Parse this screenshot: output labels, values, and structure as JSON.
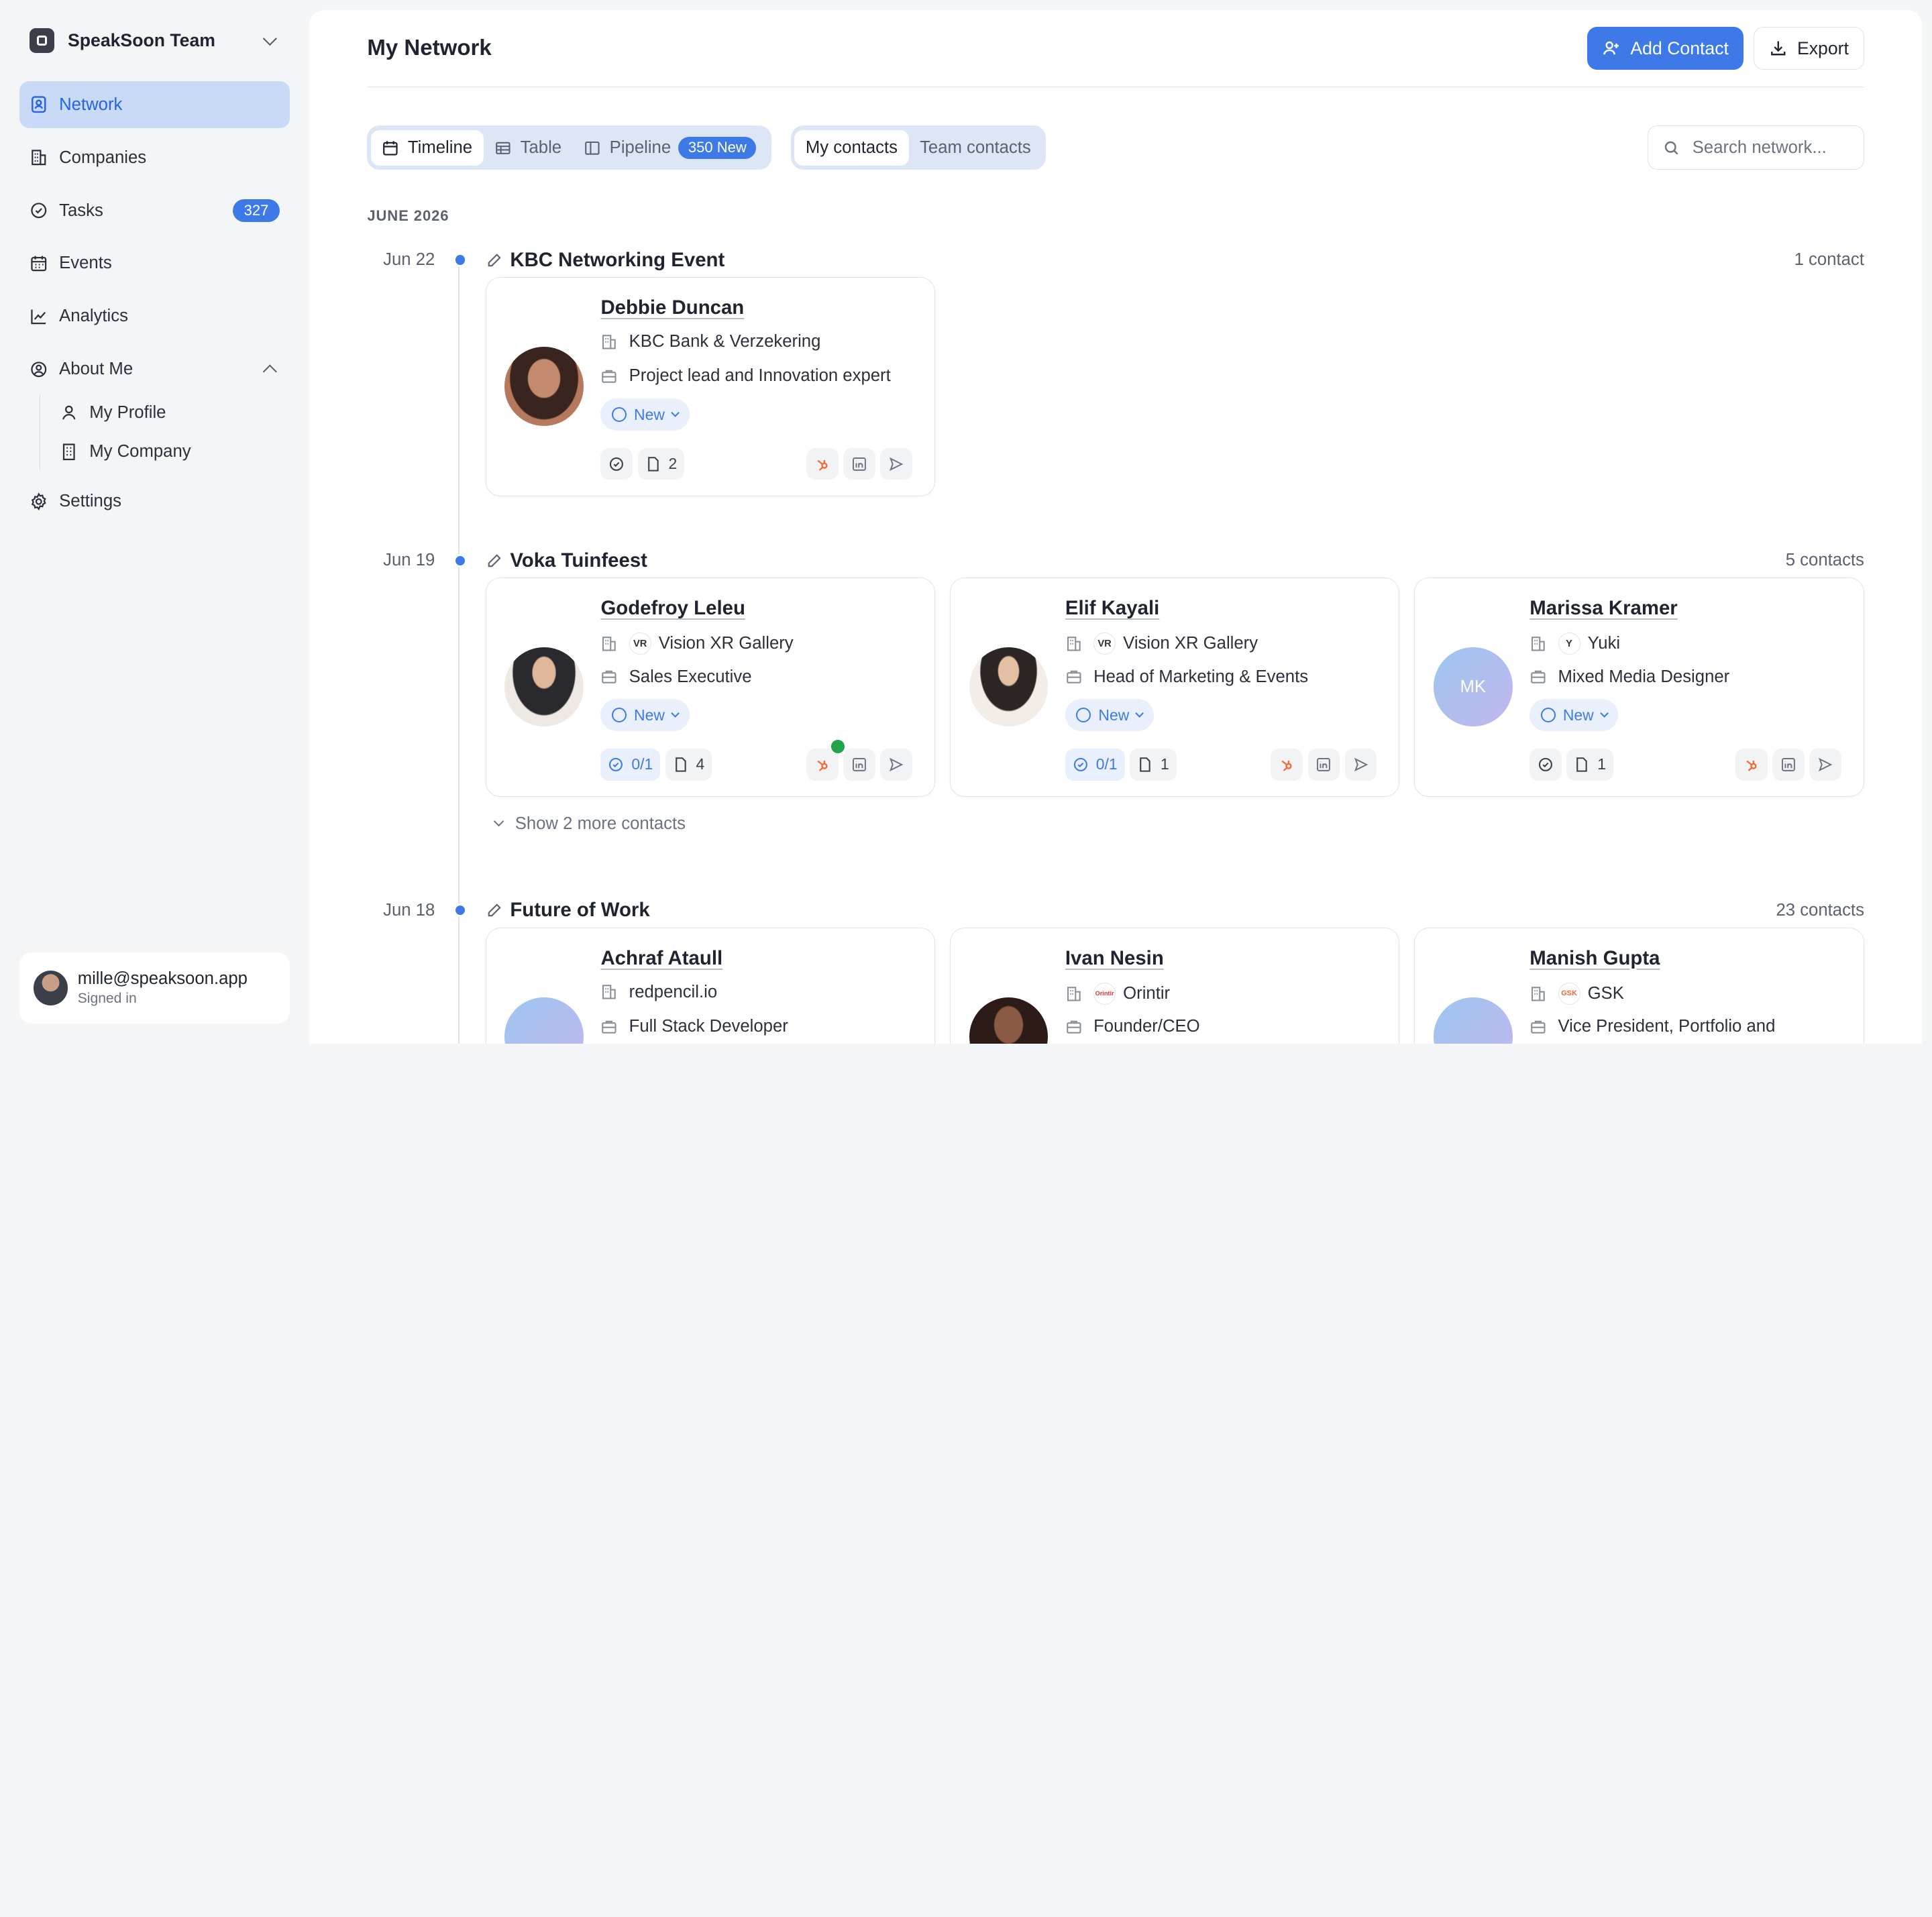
{
  "sidebar": {
    "team_name": "SpeakSoon Team",
    "items": [
      {
        "label": "Network"
      },
      {
        "label": "Companies"
      },
      {
        "label": "Tasks",
        "badge": "327"
      },
      {
        "label": "Events"
      },
      {
        "label": "Analytics"
      },
      {
        "label": "About Me"
      }
    ],
    "sub_items": [
      {
        "label": "My Profile"
      },
      {
        "label": "My Company"
      }
    ],
    "settings_label": "Settings",
    "user": {
      "email": "mille@speaksoon.app",
      "status": "Signed in"
    }
  },
  "header": {
    "title": "My Network",
    "add_contact": "Add Contact",
    "export": "Export"
  },
  "views": {
    "timeline": "Timeline",
    "table": "Table",
    "pipeline": "Pipeline",
    "pipeline_badge": "350 New"
  },
  "scope": {
    "mine": "My contacts",
    "team": "Team contacts"
  },
  "search": {
    "placeholder": "Search network..."
  },
  "month_label": "JUNE 2026",
  "groups": [
    {
      "date": "Jun 22",
      "title": "KBC Networking Event",
      "count": "1 contact",
      "contacts": [
        {
          "name": "Debbie Duncan",
          "company": "KBC Bank & Verzekering",
          "role": "Project lead and Innovation expert",
          "status": "New",
          "notes": "2"
        }
      ]
    },
    {
      "date": "Jun 19",
      "title": "Voka Tuinfeest",
      "count": "5 contacts",
      "contacts": [
        {
          "name": "Godefroy Leleu",
          "company": "Vision XR Gallery",
          "company_logo": "VR",
          "role": "Sales Executive",
          "status": "New",
          "tasks": "0/1",
          "notes": "4"
        },
        {
          "name": "Elif Kayali",
          "company": "Vision XR Gallery",
          "company_logo": "VR",
          "role": "Head of Marketing & Events",
          "status": "New",
          "tasks": "0/1",
          "notes": "1"
        },
        {
          "name": "Marissa Kramer",
          "initials": "MK",
          "company": "Yuki",
          "company_logo": "Y",
          "role": "Mixed Media Designer",
          "status": "New",
          "notes": "1"
        }
      ],
      "show_more": "Show 2 more contacts"
    },
    {
      "date": "Jun 18",
      "title": "Future of Work",
      "count": "23 contacts",
      "contacts": [
        {
          "name": "Achraf Ataull",
          "company": "redpencil.io",
          "role": "Full Stack Developer"
        },
        {
          "name": "Ivan Nesin",
          "company": "Orintir",
          "company_logo": "Orintir",
          "role": "Founder/CEO"
        },
        {
          "name": "Manish Gupta",
          "company": "GSK",
          "company_logo": "GSK",
          "role": "Vice President, Portfolio and"
        }
      ]
    }
  ],
  "colors": {
    "accent": "#3d7ae8",
    "hubspot": "#f26b3a",
    "check": "#22a54a"
  }
}
